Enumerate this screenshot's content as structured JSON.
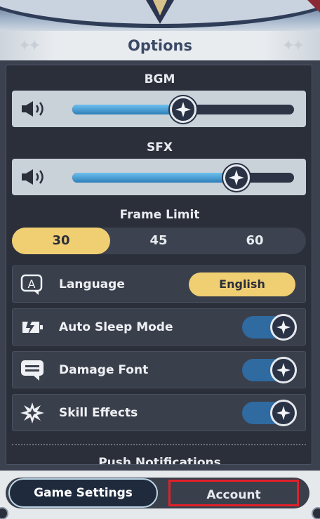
{
  "window": {
    "title": "Options"
  },
  "audio": {
    "bgm": {
      "label": "BGM",
      "value": 0.5,
      "icon": "speaker-icon"
    },
    "sfx": {
      "label": "SFX",
      "value": 0.74,
      "icon": "speaker-icon"
    }
  },
  "frame_limit": {
    "label": "Frame Limit",
    "options": [
      "30",
      "45",
      "60"
    ],
    "selected": "30"
  },
  "options": {
    "language": {
      "label": "Language",
      "value": "English",
      "icon": "language-icon"
    },
    "auto_sleep": {
      "label": "Auto Sleep Mode",
      "enabled": true,
      "icon": "battery-sleep-icon"
    },
    "damage_font": {
      "label": "Damage Font",
      "enabled": true,
      "icon": "chat-bubble-icon"
    },
    "skill_effects": {
      "label": "Skill Effects",
      "enabled": true,
      "icon": "burst-icon"
    }
  },
  "push_notifications": {
    "label": "Push Notifications"
  },
  "tabs": [
    {
      "label": "Game Settings",
      "active": true
    },
    {
      "label": "Account",
      "active": false
    }
  ],
  "colors": {
    "accent_yellow": "#f0cf73",
    "toggle_blue": "#2f6aa0",
    "panel_bg": "#2b2f3a",
    "highlight_red": "#e2202a"
  }
}
